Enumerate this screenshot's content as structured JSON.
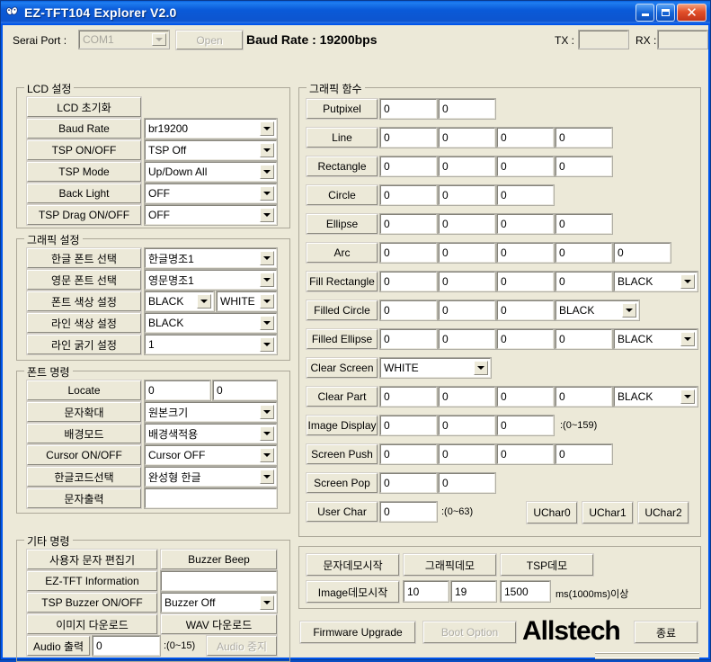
{
  "window": {
    "title": "EZ-TFT104 Explorer V2.0",
    "icon": "app-icon",
    "minimize": "minimize-icon",
    "maximize": "maximize-icon",
    "close": "close-icon"
  },
  "topbar": {
    "serial_label": "Serai Port :",
    "port_value": "COM1",
    "open_label": "Open",
    "baud_label": "Baud Rate : 19200bps",
    "tx_label": "TX :",
    "tx_value": "",
    "rx_label": "RX :",
    "rx_value": ""
  },
  "lcd_settings": {
    "title": "LCD 설정",
    "rows": [
      {
        "button": "LCD 초기화",
        "type": "none",
        "value": ""
      },
      {
        "button": "Baud Rate",
        "type": "combo",
        "value": "br19200"
      },
      {
        "button": "TSP ON/OFF",
        "type": "combo",
        "value": "TSP Off"
      },
      {
        "button": "TSP Mode",
        "type": "combo",
        "value": "Up/Down All"
      },
      {
        "button": "Back Light",
        "type": "combo",
        "value": "OFF"
      },
      {
        "button": "TSP Drag ON/OFF",
        "type": "combo",
        "value": "OFF"
      }
    ]
  },
  "graphic_settings": {
    "title": "그래픽 설정",
    "rows": [
      {
        "button": "한글 폰트 선택",
        "type": "combo",
        "value": "한글명조1"
      },
      {
        "button": "영문 폰트 선택",
        "type": "combo",
        "value": "영문명조1"
      },
      {
        "button": "폰트 색상 설정",
        "type": "combo2",
        "value": "BLACK",
        "value2": "WHITE"
      },
      {
        "button": "라인 색상 설정",
        "type": "combo",
        "value": "BLACK"
      },
      {
        "button": "라인 굵기 설정",
        "type": "combo",
        "value": "1"
      }
    ]
  },
  "font_commands": {
    "title": "폰트 명령",
    "rows": [
      {
        "button": "Locate",
        "type": "two-text",
        "value": "0",
        "value2": "0"
      },
      {
        "button": "문자확대",
        "type": "combo",
        "value": "원본크기"
      },
      {
        "button": "배경모드",
        "type": "combo",
        "value": "배경색적용"
      },
      {
        "button": "Cursor ON/OFF",
        "type": "combo",
        "value": "Cursor OFF"
      },
      {
        "button": "한글코드선택",
        "type": "combo",
        "value": "완성형 한글"
      },
      {
        "button": "문자출력",
        "type": "text",
        "value": ""
      }
    ]
  },
  "other_commands": {
    "title": "기타 명령",
    "row1": {
      "left": "사용자 문자 편집기",
      "right": "Buzzer Beep"
    },
    "row2": {
      "left": "EZ-TFT Information",
      "value": ""
    },
    "row3": {
      "left": "TSP Buzzer ON/OFF",
      "value": "Buzzer Off"
    },
    "row4": {
      "left": "이미지 다운로드",
      "right": "WAV 다운로드"
    },
    "row5": {
      "left": "Audio 출력",
      "value": "0",
      "note": ":(0~15)",
      "right": "Audio 중지"
    }
  },
  "graphic_functions": {
    "title": "그래픽 함수",
    "rows": [
      {
        "button": "Putpixel",
        "fields": [
          "0",
          "0"
        ]
      },
      {
        "button": "Line",
        "fields": [
          "0",
          "0",
          "0",
          "0"
        ]
      },
      {
        "button": "Rectangle",
        "fields": [
          "0",
          "0",
          "0",
          "0"
        ]
      },
      {
        "button": "Circle",
        "fields": [
          "0",
          "0",
          "0"
        ]
      },
      {
        "button": "Ellipse",
        "fields": [
          "0",
          "0",
          "0",
          "0"
        ]
      },
      {
        "button": "Arc",
        "fields": [
          "0",
          "0",
          "0",
          "0",
          "0"
        ]
      },
      {
        "button": "Fill Rectangle",
        "fields": [
          "0",
          "0",
          "0",
          "0"
        ],
        "combo": "BLACK"
      },
      {
        "button": "Filled Circle",
        "fields": [
          "0",
          "0",
          "0"
        ],
        "combo": "BLACK"
      },
      {
        "button": "Filled Ellipse",
        "fields": [
          "0",
          "0",
          "0",
          "0"
        ],
        "combo": "BLACK"
      },
      {
        "button": "Clear Screen",
        "fields": [],
        "combo": "WHITE"
      },
      {
        "button": "Clear Part",
        "fields": [
          "0",
          "0",
          "0",
          "0"
        ],
        "combo": "BLACK"
      },
      {
        "button": "Image Display",
        "fields": [
          "0",
          "0",
          "0"
        ],
        "note": ":(0~159)"
      },
      {
        "button": "Screen Push",
        "fields": [
          "0",
          "0",
          "0",
          "0"
        ]
      },
      {
        "button": "Screen Pop",
        "fields": [
          "0",
          "0"
        ]
      },
      {
        "button": "User Char",
        "fields": [
          "0"
        ],
        "note": ":(0~63)",
        "extra_buttons": [
          "UChar0",
          "UChar1",
          "UChar2"
        ]
      }
    ]
  },
  "demo_panel": {
    "buttons_row1": [
      "문자데모시작",
      "그래픽데모",
      "TSP데모"
    ],
    "image_demo_label": "Image데모시작",
    "field1": "10",
    "field2": "19",
    "field3": "1500",
    "note": "ms(1000ms)이상"
  },
  "footer": {
    "firmware_label": "Firmware Upgrade",
    "boot_label": "Boot Option",
    "brand": "Allstech",
    "exit_label": "종료"
  }
}
